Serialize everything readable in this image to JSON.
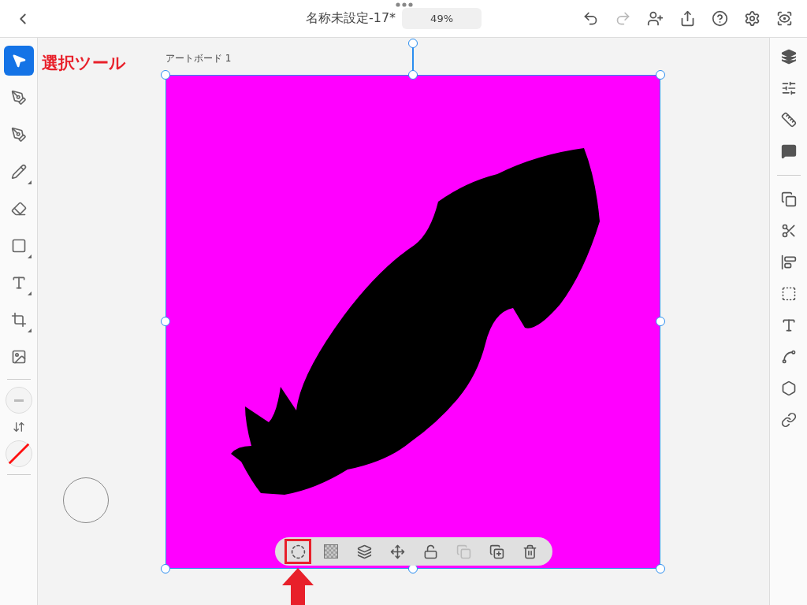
{
  "top_bar": {
    "title": "名称未設定-17*",
    "zoom": "49%",
    "actions": [
      {
        "disabled": false
      },
      {
        "disabled": true
      },
      {
        "disabled": false
      },
      {
        "disabled": false
      },
      {
        "disabled": false
      },
      {
        "disabled": false
      },
      {
        "disabled": false
      }
    ]
  },
  "left_tools": [
    {
      "selected": true,
      "has_submenu": false
    },
    {
      "selected": false,
      "has_submenu": false
    },
    {
      "selected": false,
      "has_submenu": false
    },
    {
      "selected": false,
      "has_submenu": true
    },
    {
      "selected": false,
      "has_submenu": false
    },
    {
      "selected": false,
      "has_submenu": true
    },
    {
      "selected": false,
      "has_submenu": true
    },
    {
      "selected": false,
      "has_submenu": true
    },
    {
      "selected": false,
      "has_submenu": false
    }
  ],
  "annotation": {
    "text": "選択ツール"
  },
  "artboard": {
    "label": "アートボード 1",
    "color": "#ff00ff"
  },
  "context_toolbar": [
    {
      "disabled": false,
      "highlighted": true
    },
    {
      "disabled": false,
      "highlighted": false
    },
    {
      "disabled": false,
      "highlighted": false
    },
    {
      "disabled": false,
      "highlighted": false
    },
    {
      "disabled": false,
      "highlighted": false
    },
    {
      "disabled": true,
      "highlighted": false
    },
    {
      "disabled": false,
      "highlighted": false
    },
    {
      "disabled": false,
      "highlighted": false
    }
  ]
}
